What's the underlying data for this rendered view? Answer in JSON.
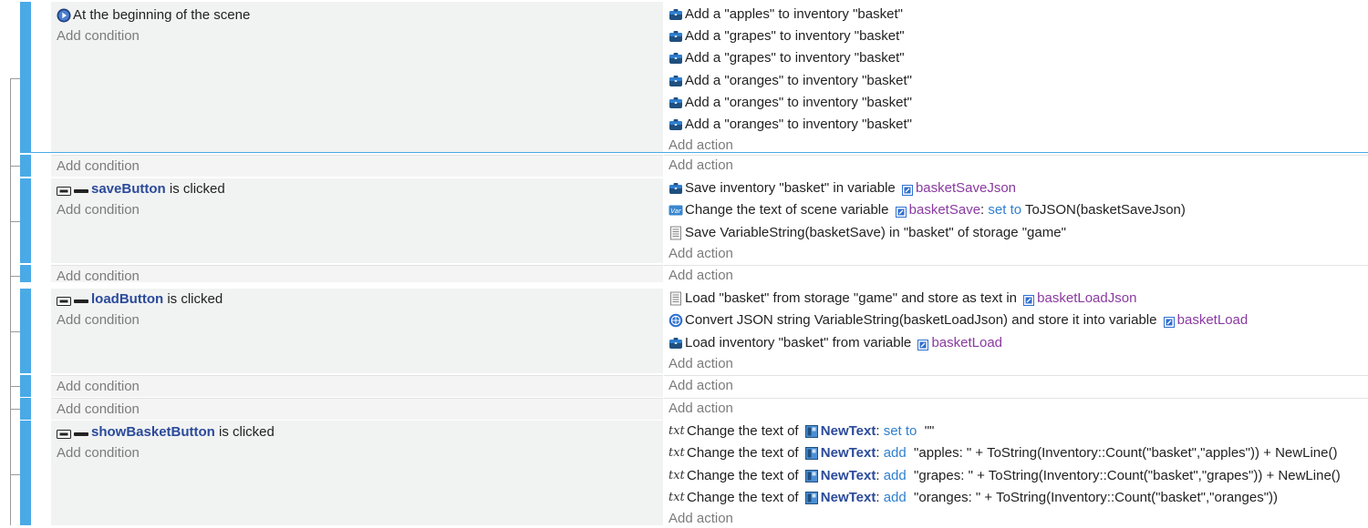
{
  "events": [
    {
      "conditions": [
        {
          "icon": "scene-play-icon",
          "text": "At the beginning of the scene"
        }
      ],
      "add_condition": "Add condition",
      "actions": [
        {
          "icon": "inventory-icon",
          "parts": [
            [
              "t",
              "Add a \"apples\" to inventory \"basket\""
            ]
          ]
        },
        {
          "icon": "inventory-icon",
          "parts": [
            [
              "t",
              "Add a \"grapes\" to inventory \"basket\""
            ]
          ]
        },
        {
          "icon": "inventory-icon",
          "parts": [
            [
              "t",
              "Add a \"grapes\" to inventory \"basket\""
            ]
          ]
        },
        {
          "icon": "inventory-icon",
          "parts": [
            [
              "t",
              "Add a \"oranges\" to inventory \"basket\""
            ]
          ]
        },
        {
          "icon": "inventory-icon",
          "parts": [
            [
              "t",
              "Add a \"oranges\" to inventory \"basket\""
            ]
          ]
        },
        {
          "icon": "inventory-icon",
          "parts": [
            [
              "t",
              "Add a \"oranges\" to inventory \"basket\""
            ]
          ]
        }
      ],
      "add_action": "Add action"
    },
    {
      "empty": true,
      "add_condition": "Add condition",
      "add_action": "Add action"
    },
    {
      "conditions": [
        {
          "icon": "button-icon",
          "object": "saveButton",
          "text": " is clicked"
        }
      ],
      "add_condition": "Add condition",
      "actions": [
        {
          "icon": "inventory-icon",
          "parts": [
            [
              "t",
              "Save inventory \"basket\" in variable "
            ],
            [
              "vi",
              ""
            ],
            [
              "v",
              "basketSaveJson"
            ]
          ]
        },
        {
          "icon": "scene-var-icon",
          "parts": [
            [
              "t",
              "Change the text of scene variable "
            ],
            [
              "vi",
              ""
            ],
            [
              "v",
              "basketSave"
            ],
            [
              "t",
              ": "
            ],
            [
              "k",
              "set to"
            ],
            [
              "t",
              " ToJSON(basketSaveJson)"
            ]
          ]
        },
        {
          "icon": "storage-icon",
          "parts": [
            [
              "t",
              "Save VariableString(basketSave) in \"basket\" of storage \"game\""
            ]
          ]
        }
      ],
      "add_action": "Add action"
    },
    {
      "empty": true,
      "add_condition": "Add condition",
      "add_action": "Add action"
    },
    {
      "conditions": [
        {
          "icon": "button-icon",
          "object": "loadButton",
          "text": " is clicked"
        }
      ],
      "add_condition": "Add condition",
      "actions": [
        {
          "icon": "storage-icon",
          "parts": [
            [
              "t",
              "Load \"basket\" from storage \"game\" and store as text in "
            ],
            [
              "vi",
              ""
            ],
            [
              "v",
              "basketLoadJson"
            ]
          ]
        },
        {
          "icon": "network-icon",
          "parts": [
            [
              "t",
              "Convert JSON string VariableString(basketLoadJson) and store it into variable "
            ],
            [
              "vi",
              ""
            ],
            [
              "v",
              "basketLoad"
            ]
          ]
        },
        {
          "icon": "inventory-icon",
          "parts": [
            [
              "t",
              "Load inventory \"basket\" from variable "
            ],
            [
              "vi",
              ""
            ],
            [
              "v",
              "basketLoad"
            ]
          ]
        }
      ],
      "add_action": "Add action"
    },
    {
      "empty": true,
      "add_condition": "Add condition",
      "add_action": "Add action"
    },
    {
      "empty": true,
      "add_condition": "Add condition",
      "add_action": "Add action"
    },
    {
      "conditions": [
        {
          "icon": "button-icon",
          "object": "showBasketButton",
          "text": " is clicked"
        }
      ],
      "add_condition": "Add condition",
      "actions": [
        {
          "icon": "text-icon",
          "parts": [
            [
              "t",
              "Change the text of "
            ],
            [
              "oi",
              ""
            ],
            [
              "o",
              "NewText"
            ],
            [
              "t",
              ": "
            ],
            [
              "k",
              "set to"
            ],
            [
              "t",
              "  \"\""
            ]
          ]
        },
        {
          "icon": "text-icon",
          "parts": [
            [
              "t",
              "Change the text of "
            ],
            [
              "oi",
              ""
            ],
            [
              "o",
              "NewText"
            ],
            [
              "t",
              ": "
            ],
            [
              "k",
              "add"
            ],
            [
              "t",
              "  \"apples: \" + ToString(Inventory::Count(\"basket\",\"apples\")) + NewLine()"
            ]
          ]
        },
        {
          "icon": "text-icon",
          "parts": [
            [
              "t",
              "Change the text of "
            ],
            [
              "oi",
              ""
            ],
            [
              "o",
              "NewText"
            ],
            [
              "t",
              ": "
            ],
            [
              "k",
              "add"
            ],
            [
              "t",
              "  \"grapes: \" + ToString(Inventory::Count(\"basket\",\"grapes\")) + NewLine()"
            ]
          ]
        },
        {
          "icon": "text-icon",
          "parts": [
            [
              "t",
              "Change the text of "
            ],
            [
              "oi",
              ""
            ],
            [
              "o",
              "NewText"
            ],
            [
              "t",
              ": "
            ],
            [
              "k",
              "add"
            ],
            [
              "t",
              "  \"oranges: \" + ToString(Inventory::Count(\"basket\",\"oranges\"))"
            ]
          ]
        }
      ],
      "add_action": "Add action"
    }
  ],
  "text_icon_glyph": "txt"
}
